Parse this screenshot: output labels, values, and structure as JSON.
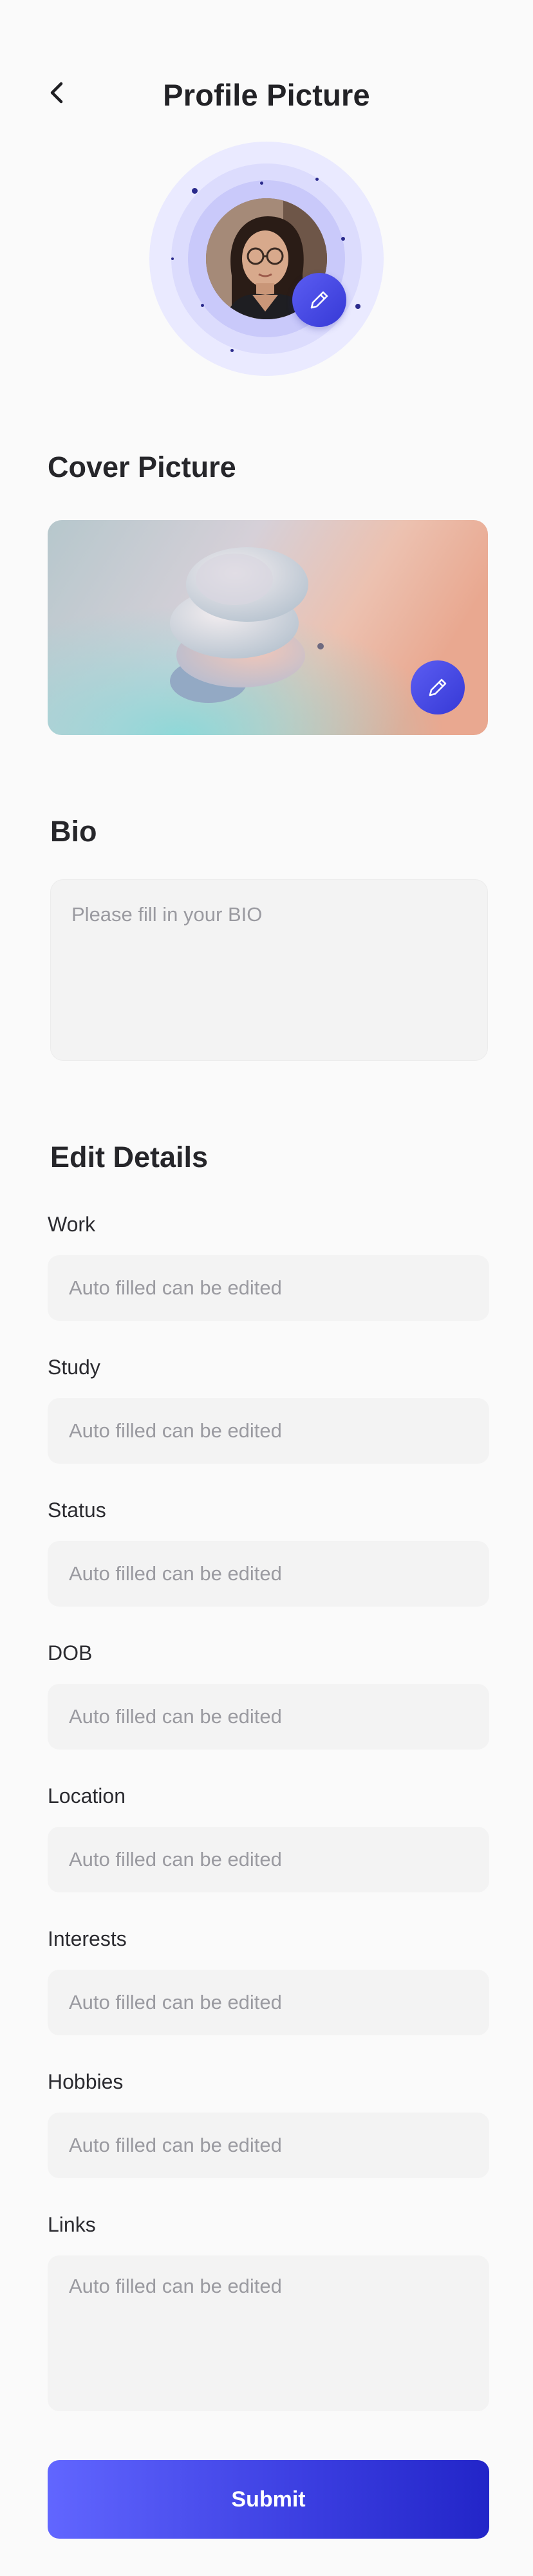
{
  "header": {
    "title": "Profile Picture",
    "back_icon": "chevron-left-icon"
  },
  "avatar": {
    "edit_icon": "pencil-icon",
    "accent_color": "#4649e8"
  },
  "cover": {
    "title": "Cover Picture",
    "edit_icon": "pencil-icon"
  },
  "bio": {
    "title": "Bio",
    "placeholder": "Please fill in your BIO"
  },
  "details": {
    "title": "Edit Details",
    "fields": [
      {
        "label": "Work",
        "placeholder": "Auto filled can be edited"
      },
      {
        "label": "Study",
        "placeholder": "Auto filled can be edited"
      },
      {
        "label": "Status",
        "placeholder": "Auto filled can be edited"
      },
      {
        "label": "DOB",
        "placeholder": "Auto filled can be edited"
      },
      {
        "label": "Location",
        "placeholder": "Auto filled can be edited"
      },
      {
        "label": "Interests",
        "placeholder": "Auto filled can be edited"
      },
      {
        "label": "Hobbies",
        "placeholder": "Auto filled can be edited"
      },
      {
        "label": "Links",
        "placeholder": "Auto filled can be edited"
      }
    ]
  },
  "submit": {
    "label": "Submit",
    "color": "#3a3de0"
  }
}
